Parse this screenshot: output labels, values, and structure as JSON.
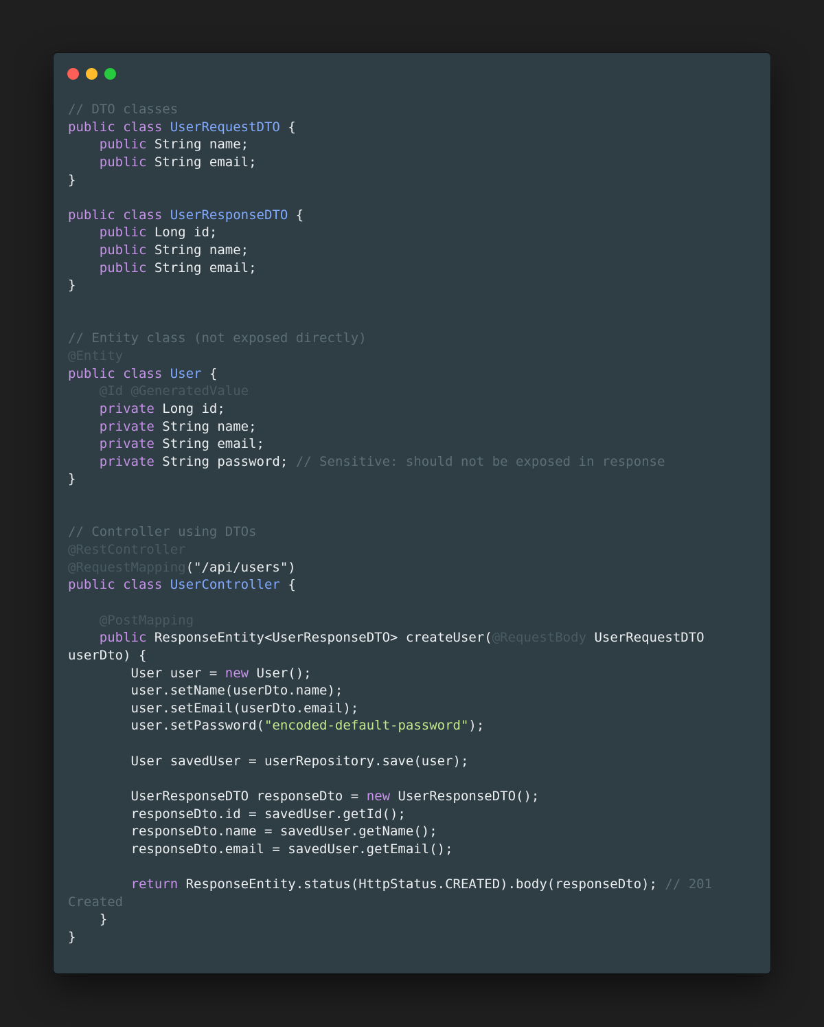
{
  "colors": {
    "page_background": "#1f1f1f",
    "window_background": "#2f3d44",
    "close_button": "#ff5f56",
    "minimize_button": "#ffbd2e",
    "zoom_button": "#27c93f",
    "comment": "#5d6e77",
    "annotation": "#4a5a62",
    "keyword": "#c792ea",
    "type_name": "#82aaff",
    "string": "#c3e88d",
    "plain_text": "#eceff1"
  },
  "window": {
    "controls": [
      {
        "name": "close-button",
        "icon": "red-dot-icon"
      },
      {
        "name": "minimize-button",
        "icon": "yellow-dot-icon"
      },
      {
        "name": "zoom-button",
        "icon": "green-dot-icon"
      }
    ]
  },
  "code": {
    "language": "java",
    "lines": [
      [
        {
          "t": "comment",
          "s": "// DTO classes"
        }
      ],
      [
        {
          "t": "keyword",
          "s": "public class "
        },
        {
          "t": "type",
          "s": "UserRequestDTO"
        },
        {
          "t": "plain",
          "s": " {"
        }
      ],
      [
        {
          "t": "plain",
          "s": "    "
        },
        {
          "t": "keyword",
          "s": "public"
        },
        {
          "t": "plain",
          "s": " String name;"
        }
      ],
      [
        {
          "t": "plain",
          "s": "    "
        },
        {
          "t": "keyword",
          "s": "public"
        },
        {
          "t": "plain",
          "s": " String email;"
        }
      ],
      [
        {
          "t": "plain",
          "s": "}"
        }
      ],
      [],
      [
        {
          "t": "keyword",
          "s": "public class "
        },
        {
          "t": "type",
          "s": "UserResponseDTO"
        },
        {
          "t": "plain",
          "s": " {"
        }
      ],
      [
        {
          "t": "plain",
          "s": "    "
        },
        {
          "t": "keyword",
          "s": "public"
        },
        {
          "t": "plain",
          "s": " Long id;"
        }
      ],
      [
        {
          "t": "plain",
          "s": "    "
        },
        {
          "t": "keyword",
          "s": "public"
        },
        {
          "t": "plain",
          "s": " String name;"
        }
      ],
      [
        {
          "t": "plain",
          "s": "    "
        },
        {
          "t": "keyword",
          "s": "public"
        },
        {
          "t": "plain",
          "s": " String email;"
        }
      ],
      [
        {
          "t": "plain",
          "s": "}"
        }
      ],
      [],
      [],
      [
        {
          "t": "comment",
          "s": "// Entity class (not exposed directly)"
        }
      ],
      [
        {
          "t": "annotation",
          "s": "@Entity"
        }
      ],
      [
        {
          "t": "keyword",
          "s": "public class "
        },
        {
          "t": "type",
          "s": "User"
        },
        {
          "t": "plain",
          "s": " {"
        }
      ],
      [
        {
          "t": "plain",
          "s": "    "
        },
        {
          "t": "annotation",
          "s": "@Id @GeneratedValue"
        }
      ],
      [
        {
          "t": "plain",
          "s": "    "
        },
        {
          "t": "keyword",
          "s": "private"
        },
        {
          "t": "plain",
          "s": " Long id;"
        }
      ],
      [
        {
          "t": "plain",
          "s": "    "
        },
        {
          "t": "keyword",
          "s": "private"
        },
        {
          "t": "plain",
          "s": " String name;"
        }
      ],
      [
        {
          "t": "plain",
          "s": "    "
        },
        {
          "t": "keyword",
          "s": "private"
        },
        {
          "t": "plain",
          "s": " String email;"
        }
      ],
      [
        {
          "t": "plain",
          "s": "    "
        },
        {
          "t": "keyword",
          "s": "private"
        },
        {
          "t": "plain",
          "s": " String password; "
        },
        {
          "t": "comment",
          "s": "// Sensitive: should not be exposed in response"
        }
      ],
      [
        {
          "t": "plain",
          "s": "}"
        }
      ],
      [],
      [],
      [
        {
          "t": "comment",
          "s": "// Controller using DTOs"
        }
      ],
      [
        {
          "t": "annotation",
          "s": "@RestController"
        }
      ],
      [
        {
          "t": "annotation",
          "s": "@RequestMapping"
        },
        {
          "t": "plain",
          "s": "(\"/api/users\")"
        }
      ],
      [
        {
          "t": "keyword",
          "s": "public class "
        },
        {
          "t": "type",
          "s": "UserController"
        },
        {
          "t": "plain",
          "s": " {"
        }
      ],
      [],
      [
        {
          "t": "plain",
          "s": "    "
        },
        {
          "t": "annotation",
          "s": "@PostMapping"
        }
      ],
      [
        {
          "t": "plain",
          "s": "    "
        },
        {
          "t": "keyword",
          "s": "public"
        },
        {
          "t": "plain",
          "s": " ResponseEntity<UserResponseDTO> createUser("
        },
        {
          "t": "annotation",
          "s": "@RequestBody"
        },
        {
          "t": "plain",
          "s": " UserRequestDTO"
        }
      ],
      [
        {
          "t": "plain",
          "s": "userDto) {"
        }
      ],
      [
        {
          "t": "plain",
          "s": "        User user = "
        },
        {
          "t": "keyword",
          "s": "new"
        },
        {
          "t": "plain",
          "s": " User();"
        }
      ],
      [
        {
          "t": "plain",
          "s": "        user.setName(userDto.name);"
        }
      ],
      [
        {
          "t": "plain",
          "s": "        user.setEmail(userDto.email);"
        }
      ],
      [
        {
          "t": "plain",
          "s": "        user.setPassword("
        },
        {
          "t": "string",
          "s": "\"encoded-default-password\""
        },
        {
          "t": "plain",
          "s": ");"
        }
      ],
      [],
      [
        {
          "t": "plain",
          "s": "        User savedUser = userRepository.save(user);"
        }
      ],
      [],
      [
        {
          "t": "plain",
          "s": "        UserResponseDTO responseDto = "
        },
        {
          "t": "keyword",
          "s": "new"
        },
        {
          "t": "plain",
          "s": " UserResponseDTO();"
        }
      ],
      [
        {
          "t": "plain",
          "s": "        responseDto.id = savedUser.getId();"
        }
      ],
      [
        {
          "t": "plain",
          "s": "        responseDto.name = savedUser.getName();"
        }
      ],
      [
        {
          "t": "plain",
          "s": "        responseDto.email = savedUser.getEmail();"
        }
      ],
      [],
      [
        {
          "t": "plain",
          "s": "        "
        },
        {
          "t": "keyword",
          "s": "return"
        },
        {
          "t": "plain",
          "s": " ResponseEntity.status(HttpStatus.CREATED).body(responseDto); "
        },
        {
          "t": "comment",
          "s": "// 201"
        }
      ],
      [
        {
          "t": "comment",
          "s": "Created"
        }
      ],
      [
        {
          "t": "plain",
          "s": "    }"
        }
      ],
      [
        {
          "t": "plain",
          "s": "}"
        }
      ]
    ]
  }
}
